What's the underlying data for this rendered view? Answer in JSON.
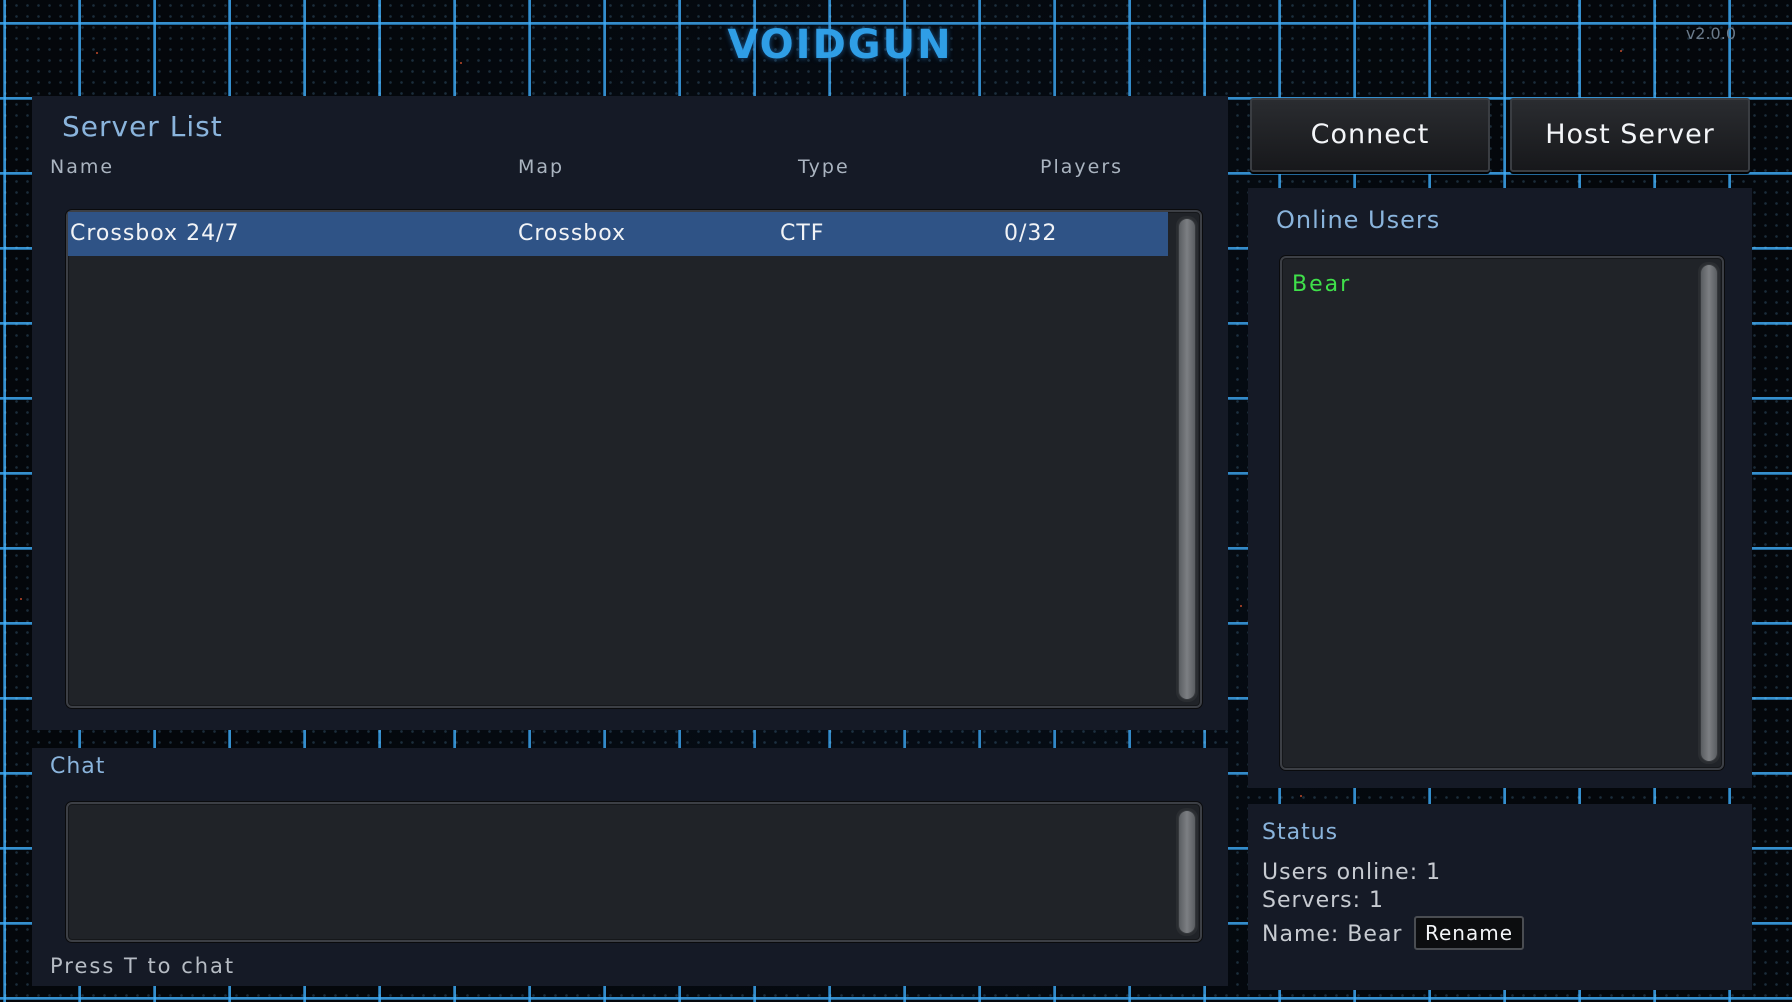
{
  "app": {
    "title": "VOIDGUN",
    "version": "v2.0.0"
  },
  "server_list": {
    "title": "Server List",
    "columns": [
      "Name",
      "Map",
      "Type",
      "Players"
    ],
    "rows": [
      {
        "name": "Crossbox 24/7",
        "map": "Crossbox",
        "type": "CTF",
        "players": "0/32",
        "selected": true
      }
    ]
  },
  "toolbar": {
    "connect_label": "Connect",
    "host_label": "Host Server"
  },
  "online_users": {
    "title": "Online Users",
    "users": [
      "Bear"
    ]
  },
  "chat": {
    "title": "Chat",
    "hint": "Press T to chat"
  },
  "status": {
    "title": "Status",
    "users_online": "Users online: 1",
    "servers": "Servers: 1",
    "name": "Name: Bear",
    "rename_label": "Rename"
  },
  "colors": {
    "accent": "#2f9ee6",
    "selected_row": "#2f5386",
    "online_user": "#3fe04a",
    "panel_bg": "#151a26"
  }
}
